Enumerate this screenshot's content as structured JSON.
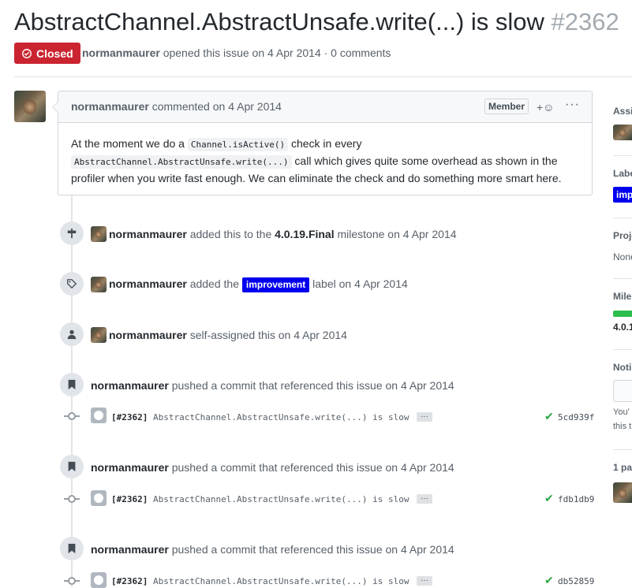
{
  "issue": {
    "title": "AbstractChannel.AbstractUnsafe.write(...) is slow",
    "number": "#2362",
    "state": "Closed",
    "author": "normanmaurer",
    "opened_text": "opened this issue on 4 Apr 2014 · 0 comments"
  },
  "comment": {
    "author": "normanmaurer",
    "action": "commented on 4 Apr 2014",
    "badge": "Member",
    "reaction": "+☺",
    "more": "···",
    "body_part1": "At the moment we do a ",
    "code1": "Channel.isActive()",
    "body_part2": " check in every ",
    "code2": "AbstractChannel.AbstractUnsafe.write(...)",
    "body_part3": " call which gives quite some overhead as shown in the profiler when you write fast enough. We can eliminate the check and do something more smart here."
  },
  "events": {
    "milestone": {
      "author": "normanmaurer",
      "pre": "added this to the",
      "milestone": "4.0.19.Final",
      "post": "milestone on 4 Apr 2014"
    },
    "label": {
      "author": "normanmaurer",
      "pre": "added the",
      "label": "improvement",
      "post": "label on 4 Apr 2014"
    },
    "assign": {
      "author": "normanmaurer",
      "text": "self-assigned this on 4 Apr 2014"
    }
  },
  "pushes": [
    {
      "author": "normanmaurer",
      "text": "pushed a commit that referenced this issue on 4 Apr 2014",
      "ref": "[#2362]",
      "message": "AbstractChannel.AbstractUnsafe.write(...) is slow",
      "ellipsis": "…",
      "sha": "5cd939f"
    },
    {
      "author": "normanmaurer",
      "text": "pushed a commit that referenced this issue on 4 Apr 2014",
      "ref": "[#2362]",
      "message": "AbstractChannel.AbstractUnsafe.write(...) is slow",
      "ellipsis": "…",
      "sha": "fdb1db9"
    },
    {
      "author": "normanmaurer",
      "text": "pushed a commit that referenced this issue on 4 Apr 2014",
      "ref": "[#2362]",
      "message": "AbstractChannel.AbstractUnsafe.write(...) is slow",
      "ellipsis": "…",
      "sha": "db52859"
    }
  ],
  "sidebar": {
    "assignees": "Assig",
    "labels": "Labe",
    "label_chip": "impr",
    "projects": "Proje",
    "projects_value": "None",
    "milestone": "Mile",
    "milestone_value": "4.0.1",
    "milestone_progress": 1.0,
    "notifications": "Noti",
    "notif_text1": "You'",
    "notif_text2": "this t",
    "participants": "1 pa"
  },
  "colors": {
    "closed": "#cb2431",
    "label": "#0000ee",
    "check": "#28a745",
    "progress": "#2cbe4e"
  }
}
